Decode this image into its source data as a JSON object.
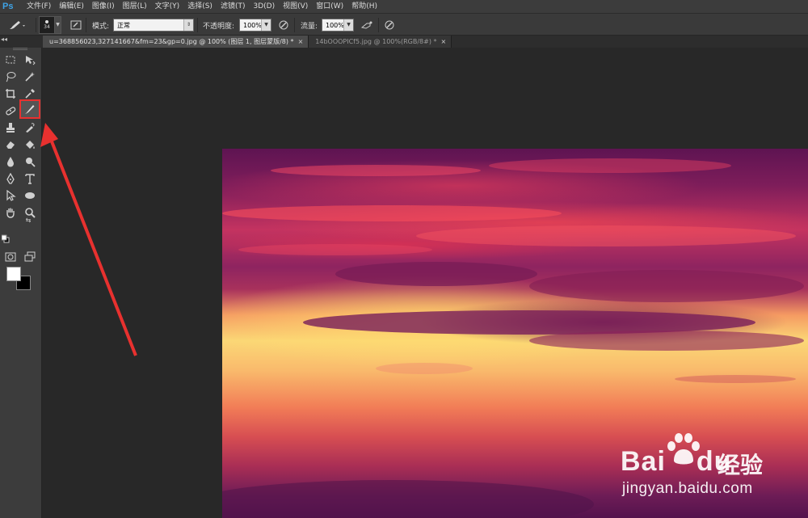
{
  "app": {
    "logo": "Ps"
  },
  "menu": [
    "文件(F)",
    "编辑(E)",
    "图像(I)",
    "图层(L)",
    "文字(Y)",
    "选择(S)",
    "滤镜(T)",
    "3D(D)",
    "视图(V)",
    "窗口(W)",
    "帮助(H)"
  ],
  "options": {
    "brush_size": "34",
    "mode_label": "模式:",
    "mode_value": "正常",
    "opacity_label": "不透明度:",
    "opacity_value": "100%",
    "flow_label": "流量:",
    "flow_value": "100%"
  },
  "tabs": [
    {
      "label": "u=368856023,327141667&fm=23&gp=0.jpg @ 100% (图层 1, 图层蒙版/8) *",
      "close": "×",
      "active": true
    },
    {
      "label": "14bOOOPICf5.jpg @ 100%(RGB/8#) *",
      "close": "×",
      "active": false
    }
  ],
  "tools": {
    "selected": "brush-tool",
    "foreground_color": "#ffffff",
    "background_color": "#000000"
  },
  "watermark": {
    "logo_text": "Bai",
    "logo_text2": "du",
    "cn_text": "经验",
    "url": "jingyan.baidu.com"
  },
  "colors": {
    "annotation": "#e8312f",
    "ps_blue": "#3fa3e6"
  }
}
